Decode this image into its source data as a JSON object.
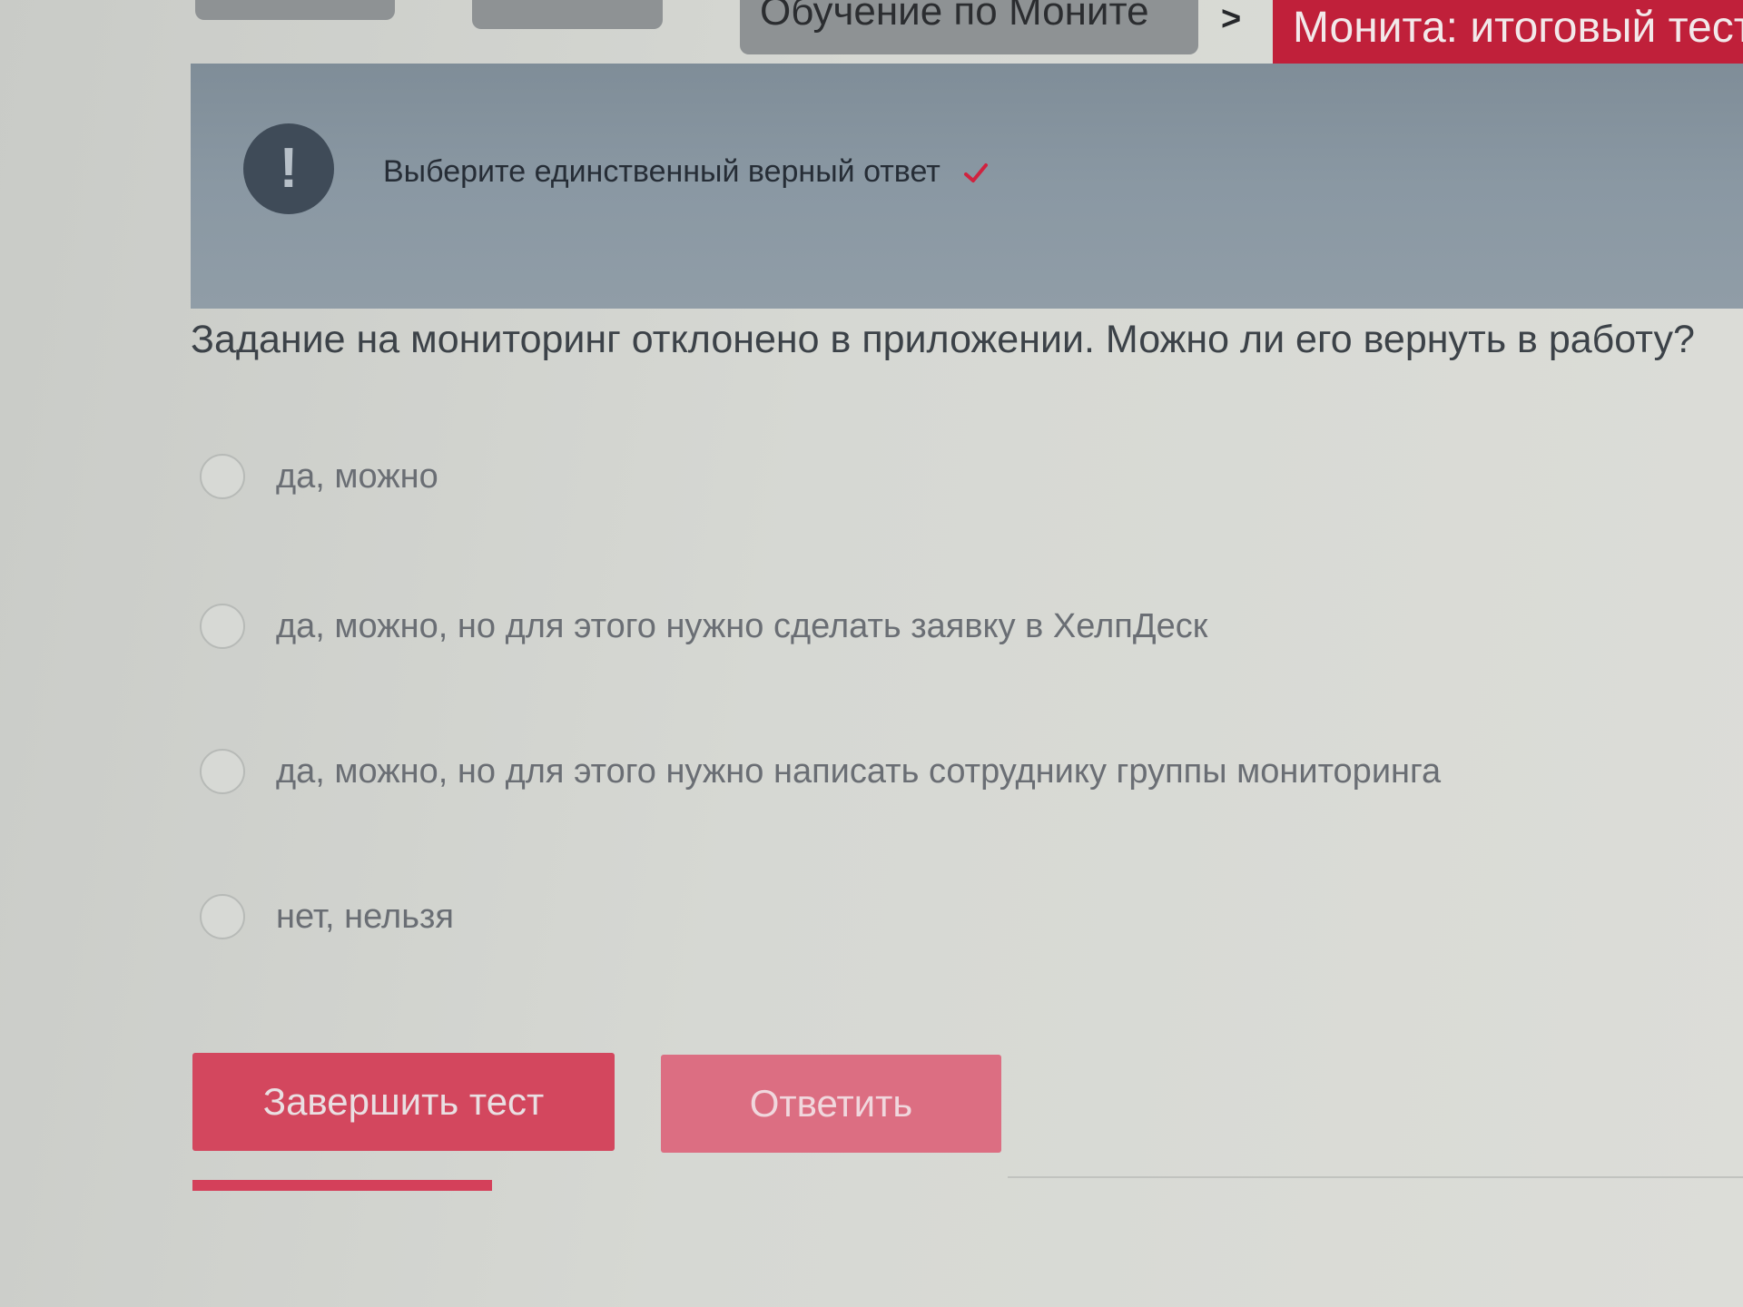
{
  "breadcrumb": {
    "items": [
      {
        "label": ""
      },
      {
        "label": ""
      },
      {
        "label": "Обучение по Моните"
      }
    ],
    "separator": ">",
    "current": "Монита: итоговый тест"
  },
  "banner": {
    "icon": "exclamation-icon",
    "icon_glyph": "!",
    "text": "Выберите единственный верный ответ",
    "check_icon": "checkmark-icon",
    "check_color": "#d0223f"
  },
  "question": {
    "text": "Задание на мониторинг отклонено в приложении. Можно ли его вернуть в работу?",
    "options": [
      {
        "label": "да, можно",
        "selected": false
      },
      {
        "label": "да, можно, но для этого нужно сделать заявку в ХелпДеск",
        "selected": false
      },
      {
        "label": "да, можно, но для этого нужно написать сотруднику группы мониторинга",
        "selected": false
      },
      {
        "label": "нет, нельзя",
        "selected": false
      }
    ]
  },
  "actions": {
    "finish_label": "Завершить тест",
    "answer_label": "Ответить"
  },
  "colors": {
    "accent": "#c0203a",
    "button_primary": "#d3475e",
    "button_secondary": "#dc6e82",
    "banner": "#8a98a3"
  }
}
